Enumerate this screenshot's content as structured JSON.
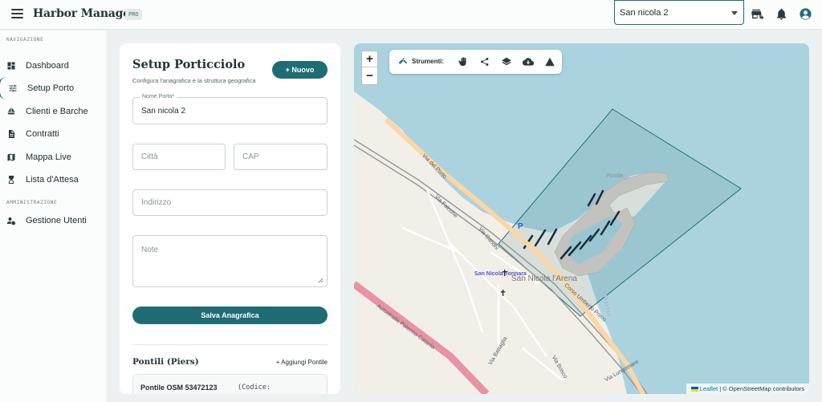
{
  "app": {
    "brand": "Harbor Manager",
    "badge": "PRO"
  },
  "header": {
    "selected_port": "San nicola 2"
  },
  "sidebar": {
    "sections": [
      {
        "label": "NAVIGAZIONE"
      },
      {
        "label": "AMMINISTRAZIONE"
      }
    ],
    "items": [
      {
        "label": "Dashboard",
        "icon": "dashboard-icon"
      },
      {
        "label": "Setup Porto",
        "icon": "tune-icon",
        "active": true
      },
      {
        "label": "Clienti e Barche",
        "icon": "sailing-icon"
      },
      {
        "label": "Contratti",
        "icon": "document-icon"
      },
      {
        "label": "Mappa Live",
        "icon": "map-icon"
      },
      {
        "label": "Lista d'Attesa",
        "icon": "hourglass-icon"
      },
      {
        "label": "Gestione Utenti",
        "icon": "manage-users-icon"
      }
    ]
  },
  "form": {
    "title": "Setup Porticciolo",
    "subtitle": "Configura l'anagrafica e la struttura geografica",
    "new_button": "+ Nuovo",
    "port_name": {
      "label": "Nome Porto*",
      "value": "San nicola 2"
    },
    "city": {
      "placeholder": "Città"
    },
    "cap": {
      "placeholder": "CAP"
    },
    "address": {
      "placeholder": "Indirizzo"
    },
    "notes": {
      "placeholder": "Note"
    },
    "save_button": "Salva Anagrafica",
    "piers_title": "Pontili (Piers)",
    "add_pier": "+ Aggiungi Pontile",
    "piers": [
      {
        "name": "Pontile OSM 53472123",
        "code": "(Codice:"
      }
    ]
  },
  "map": {
    "zoom_in": "+",
    "zoom_out": "−",
    "tools_label": "Strumenti:",
    "tools": [
      "hammer-icon",
      "hand-icon",
      "polyline-icon",
      "layers-icon",
      "cloud-download-icon",
      "triangle-icon"
    ],
    "attribution": {
      "leaflet": "Leaflet",
      "sep": "|",
      "osm": "© OpenStreetMap contributors"
    },
    "labels": {
      "town": "San Nicola l'Arena",
      "place": "San Nicola Tonnara",
      "road1": "Corso Umberto Primo",
      "road2": "Autostrada Palermo-Catania",
      "road3": "Via Gandhi",
      "road4": "Via Battaglia",
      "road5": "Via Bosco",
      "road6": "Via Lungomare",
      "road7": "Via del Porto",
      "road8": "Via Falcone",
      "parking": "P",
      "pier_label": "Pontile"
    },
    "colors": {
      "water": "#aad3df",
      "land": "#f2efe9",
      "polygon": "#1f6c75",
      "motorway": "#e892a2",
      "primary": "#fcd6a4"
    }
  }
}
